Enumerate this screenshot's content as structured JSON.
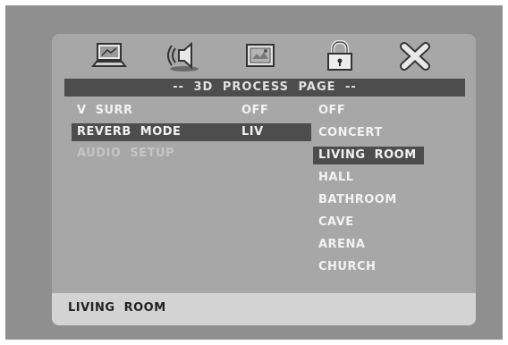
{
  "header": {
    "title": "-- 3D PROCESS PAGE --",
    "icons": [
      "general-setup-icon",
      "audio-speaker-icon",
      "video-setup-icon",
      "lock-icon",
      "exit-icon"
    ]
  },
  "menu": {
    "items": [
      {
        "label": "V SURR",
        "value": "OFF",
        "state": "normal"
      },
      {
        "label": "REVERB MODE",
        "value": "LIV",
        "state": "selected"
      },
      {
        "label": "AUDIO SETUP",
        "value": "",
        "state": "dimmed"
      }
    ]
  },
  "options": {
    "items": [
      "OFF",
      "CONCERT",
      "LIVING ROOM",
      "HALL",
      "BATHROOM",
      "CAVE",
      "ARENA",
      "CHURCH"
    ],
    "selected_index": 2
  },
  "status": {
    "text": "LIVING ROOM"
  },
  "colors": {
    "screen_bg": "#8f8f8f",
    "panel_bg": "#a7a7a7",
    "highlight_bg": "#4d4d4d",
    "text_white": "#f2f2f2",
    "status_bg": "#d3d3d3"
  }
}
